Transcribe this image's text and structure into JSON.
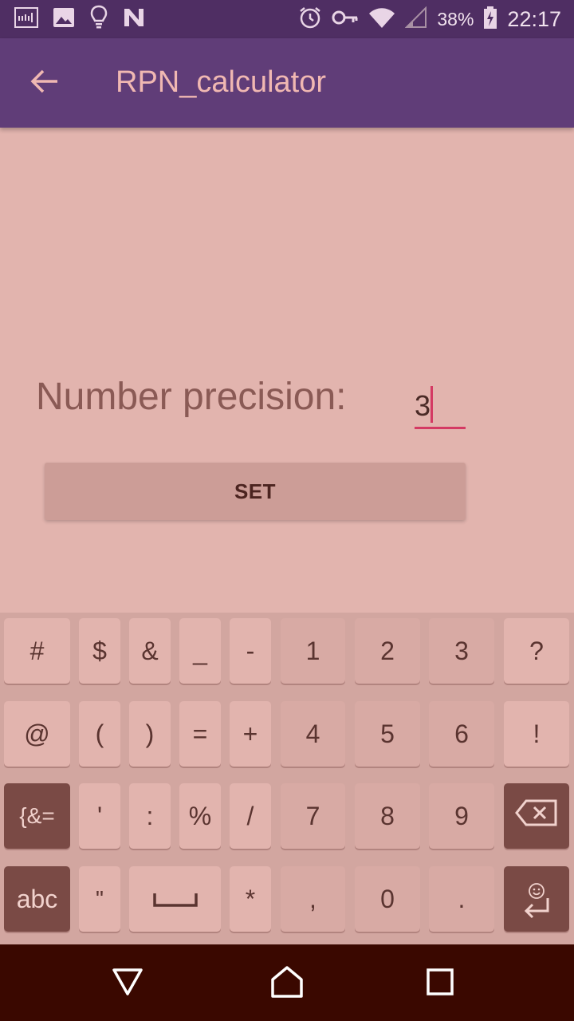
{
  "status_bar": {
    "left_icons": [
      "signal-strength-icon",
      "image-icon",
      "lightbulb-icon",
      "n-logo-icon"
    ],
    "right_icons": [
      "alarm-icon",
      "key-icon",
      "wifi-icon",
      "cell-signal-icon",
      "battery-charging-icon"
    ],
    "battery_percent": "38%",
    "time": "22:17"
  },
  "app_bar": {
    "back_icon": "arrow-back-icon",
    "title": "RPN_calculator"
  },
  "form": {
    "label": "Number precision:",
    "value": "3",
    "button": "SET"
  },
  "keyboard": {
    "rows": [
      [
        "#",
        "$",
        "&",
        "_",
        "-",
        "1",
        "2",
        "3",
        "?"
      ],
      [
        "@",
        "(",
        ")",
        "=",
        "+",
        "4",
        "5",
        "6",
        "!"
      ],
      [
        "{&=",
        "'",
        ":",
        "%",
        "/",
        "7",
        "8",
        "9",
        "backspace"
      ],
      [
        "abc",
        "\"",
        "space",
        "*",
        ",",
        "0",
        ".",
        "enter"
      ]
    ],
    "backspace_icon": "backspace-icon",
    "enter_icon": "enter-icon",
    "emoji_icon": "smiley-icon",
    "space_icon": "space-bar-icon"
  },
  "nav_bar": {
    "back": "nav-back-icon",
    "home": "nav-home-icon",
    "recents": "nav-recents-icon"
  },
  "colors": {
    "status_bar": "#4f2e63",
    "app_bar": "#603d78",
    "background": "#e2b4ae",
    "accent": "#d43a63",
    "nav_bar": "#3a0800"
  }
}
